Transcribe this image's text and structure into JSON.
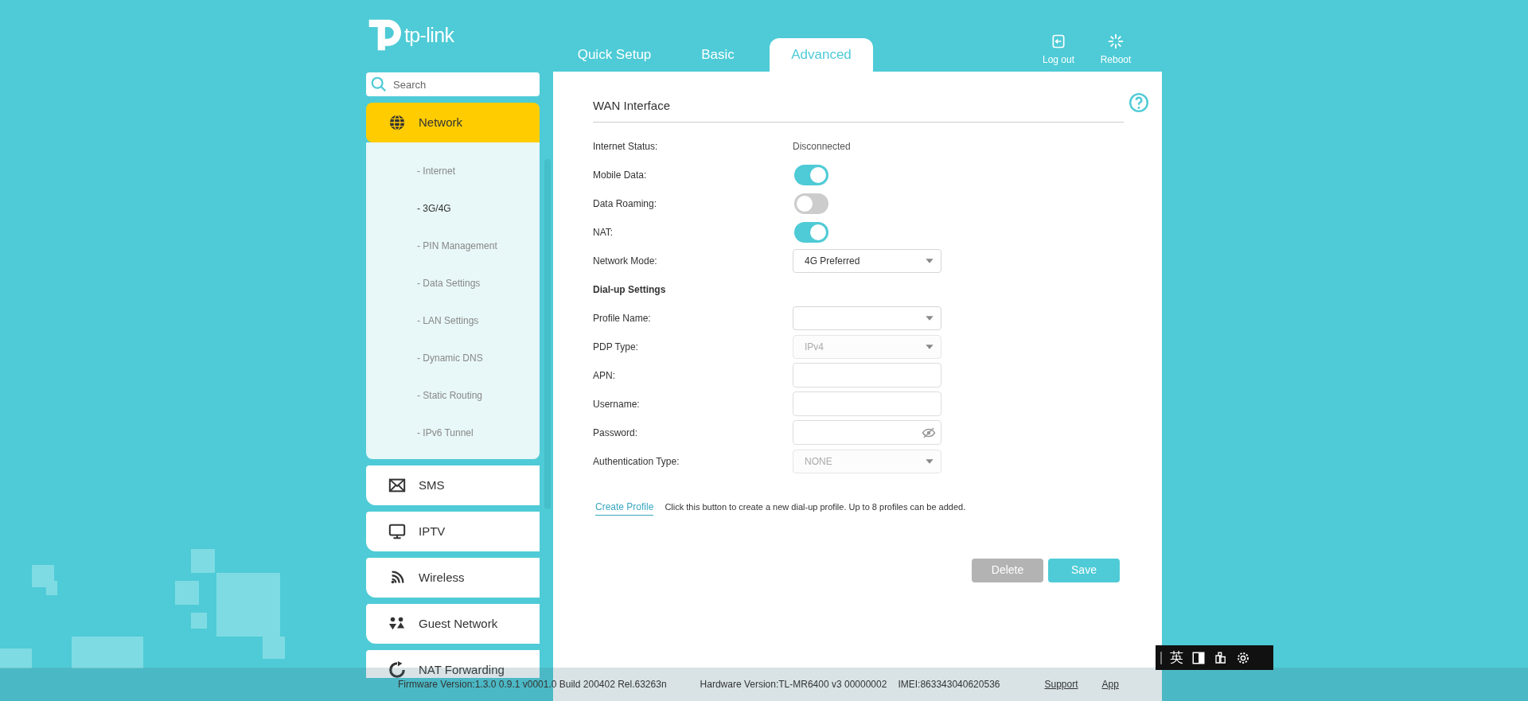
{
  "header": {
    "logo": "tp-link",
    "tabs": [
      {
        "label": "Quick Setup",
        "selected": false
      },
      {
        "label": "Basic",
        "selected": false
      },
      {
        "label": "Advanced",
        "selected": true
      }
    ],
    "actions": [
      {
        "label": "Log out",
        "kind": "logout"
      },
      {
        "label": "Reboot",
        "kind": "reboot"
      }
    ]
  },
  "sidebar": {
    "search": {
      "placeholder": "Search"
    },
    "items": [
      {
        "label": "Network",
        "kind": "globe",
        "selected": true,
        "children": [
          {
            "label": "- Internet",
            "selected": false
          },
          {
            "label": "- 3G/4G",
            "selected": true
          },
          {
            "label": "- PIN Management",
            "selected": false
          },
          {
            "label": "- Data Settings",
            "selected": false
          },
          {
            "label": "- LAN Settings",
            "selected": false
          },
          {
            "label": "- Dynamic DNS",
            "selected": false
          },
          {
            "label": "- Static Routing",
            "selected": false
          },
          {
            "label": "- IPv6 Tunnel",
            "selected": false
          }
        ]
      },
      {
        "label": "SMS",
        "kind": "envelope",
        "selected": false
      },
      {
        "label": "IPTV",
        "kind": "monitor",
        "selected": false
      },
      {
        "label": "Wireless",
        "kind": "wifi",
        "selected": false
      },
      {
        "label": "Guest Network",
        "kind": "guests",
        "selected": false
      },
      {
        "label": "NAT Forwarding",
        "kind": "refresh",
        "selected": false
      }
    ]
  },
  "content": {
    "title": "WAN Interface",
    "rows": [
      {
        "kind": "text",
        "label": "Internet Status:",
        "value": "Disconnected"
      },
      {
        "kind": "toggle",
        "label": "Mobile Data:",
        "on": true
      },
      {
        "kind": "toggle",
        "label": "Data Roaming:",
        "on": false
      },
      {
        "kind": "toggle",
        "label": "NAT:",
        "on": true
      },
      {
        "kind": "select",
        "label": "Network Mode:",
        "value": "4G Preferred",
        "disabled": false
      },
      {
        "kind": "heading",
        "label": "Dial-up Settings"
      },
      {
        "kind": "select",
        "label": "Profile Name:",
        "disabled": false
      },
      {
        "kind": "select",
        "label": "PDP Type:",
        "value": "IPv4",
        "disabled": true
      },
      {
        "kind": "input",
        "label": "APN:"
      },
      {
        "kind": "input",
        "label": "Username:"
      },
      {
        "kind": "password",
        "label": "Password:"
      },
      {
        "kind": "select",
        "label": "Authentication Type:",
        "value": "NONE",
        "disabled": true
      }
    ],
    "create_link": "Create Profile",
    "create_hint": "Click this button to create a new dial-up profile. Up to 8 profiles can be added.",
    "buttons": [
      {
        "label": "Delete",
        "kind": "delete"
      },
      {
        "label": "Save",
        "kind": "save"
      }
    ]
  },
  "footer": {
    "firmware": "Firmware Version:1.3.0 0.9.1 v0001.0 Build 200402 Rel.63263n",
    "hardware": "Hardware Version:TL-MR6400 v3 00000002",
    "imei": "IMEI:863343040620536",
    "links": [
      "Support",
      "App"
    ]
  },
  "ime_toolbar": {
    "label": "英"
  }
}
